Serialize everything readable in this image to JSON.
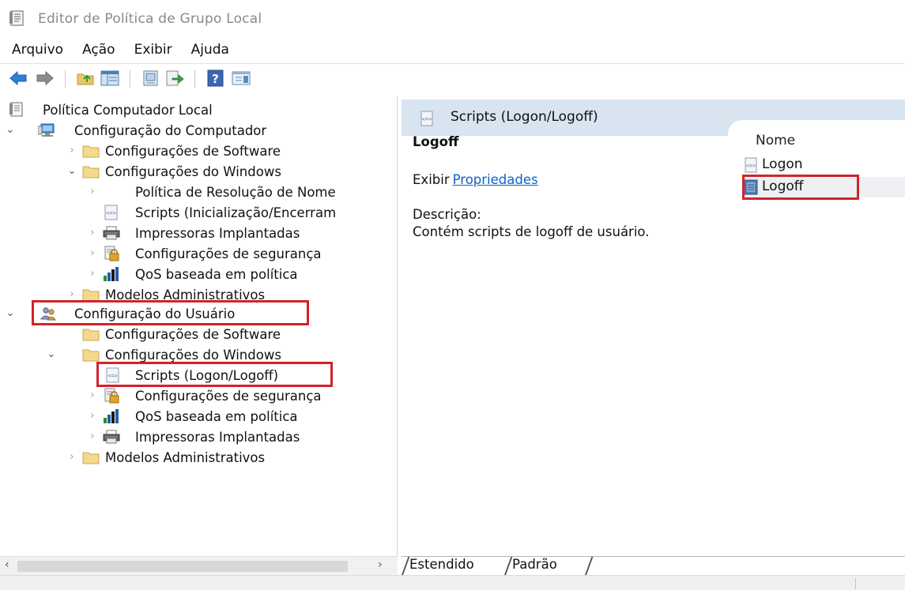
{
  "window": {
    "title": "Editor de Política de Grupo Local"
  },
  "menu": {
    "items": [
      "Arquivo",
      "Ação",
      "Exibir",
      "Ajuda"
    ]
  },
  "toolbar": {
    "buttons": [
      "back-arrow-icon",
      "forward-arrow-icon",
      "up-folder-icon",
      "show-hide-tree-icon",
      "properties-icon",
      "export-list-icon",
      "help-icon",
      "extended-view-icon"
    ]
  },
  "tree": {
    "root": "Política Computador Local",
    "computer_config": "Configuração do Computador",
    "comp_software": "Configurações de Software",
    "comp_windows": "Configurações do Windows",
    "comp_name_resolution": "Política de Resolução de Nome",
    "comp_scripts": "Scripts (Inicialização/Encerram",
    "comp_printers": "Impressoras Implantadas",
    "comp_security": "Configurações de segurança",
    "comp_qos": "QoS baseada em política",
    "comp_admin": "Modelos Administrativos",
    "user_config": "Configuração do Usuário",
    "user_software": "Configurações de Software",
    "user_windows": "Configurações do Windows",
    "user_scripts": "Scripts (Logon/Logoff)",
    "user_security": "Configurações de segurança",
    "user_qos": "QoS baseada em política",
    "user_printers": "Impressoras Implantadas",
    "user_admin": "Modelos Administrativos"
  },
  "details": {
    "header": "Scripts (Logon/Logoff)",
    "item_title": "Logoff",
    "view_prefix": "Exibir",
    "view_link": "Propriedades",
    "description_label": "Descrição:",
    "description": "Contém scripts de logoff de usuário."
  },
  "list": {
    "column_header": "Nome",
    "items": [
      "Logon",
      "Logoff"
    ],
    "selected": "Logoff"
  },
  "tabs": {
    "items": [
      "Estendido",
      "Padrão"
    ],
    "active": "Estendido"
  },
  "colors": {
    "highlight_box": "#d2232a",
    "link": "#0c62c8",
    "header_band": "#d8e4f0"
  }
}
